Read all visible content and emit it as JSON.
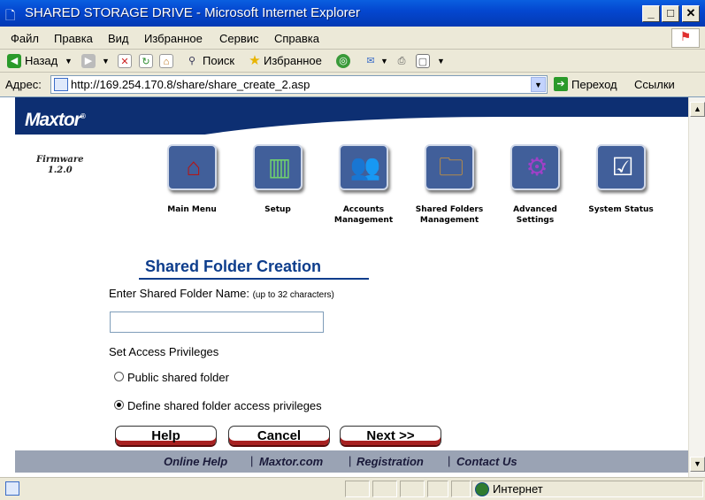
{
  "window": {
    "title": "SHARED STORAGE DRIVE - Microsoft Internet Explorer"
  },
  "menu": [
    "Файл",
    "Правка",
    "Вид",
    "Избранное",
    "Сервис",
    "Справка"
  ],
  "toolbar": {
    "back": "Назад",
    "search": "Поиск",
    "favorites": "Избранное"
  },
  "address": {
    "label": "Адрес:",
    "url": "http://169.254.170.8/share/share_create_2.asp",
    "go": "Переход",
    "links": "Ссылки"
  },
  "page": {
    "brand": "Maxtor",
    "firmware": [
      "Firmware",
      "1.2.0"
    ],
    "nav": [
      {
        "label": "Main Menu",
        "icon": "home-icon"
      },
      {
        "label": "Setup",
        "icon": "setup-icon"
      },
      {
        "label": "Accounts Management",
        "icon": "users-icon"
      },
      {
        "label": "Shared Folders Management",
        "icon": "folders-icon"
      },
      {
        "label": "Advanced Settings",
        "icon": "gears-icon"
      },
      {
        "label": "System Status",
        "icon": "checkmark-icon"
      }
    ],
    "heading": "Shared Folder Creation",
    "name_label": "Enter Shared Folder Name:",
    "name_hint": "(up to 32 characters)",
    "name_value": "",
    "privileges_label": "Set Access Privileges",
    "option_public": "Public shared folder",
    "option_define": "Define shared folder access privileges",
    "selected_option": "define",
    "buttons": {
      "help": "Help",
      "cancel": "Cancel",
      "next": "Next >>"
    },
    "footer": [
      "Online Help",
      "Maxtor.com",
      "Registration",
      "Contact Us"
    ]
  },
  "status": {
    "zone": "Интернет"
  }
}
